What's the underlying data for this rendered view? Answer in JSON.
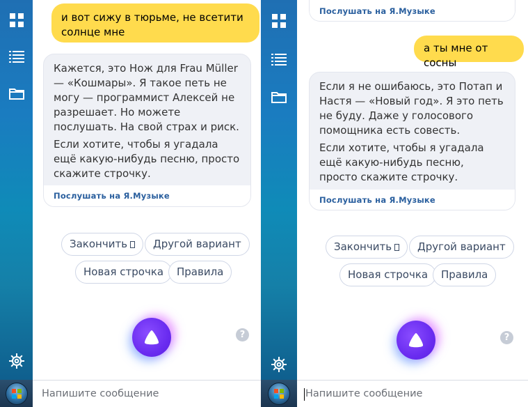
{
  "left": {
    "sidebar": {
      "icons": [
        "apps-grid-icon",
        "list-icon",
        "folder-icon",
        "settings-gear-icon"
      ]
    },
    "messages": {
      "user_text": "и вот сижу в тюрьме, не всетити солнце мне",
      "assistant_p1": "Кажется, это Нож для Frau Müller — «Кошмары». Я такое петь не могу — программист Алексей не разрешает. Но можете послушать. На свой страх и риск.",
      "assistant_p2": "Если хотите, чтобы я угадала ещё какую-нибудь песню, просто скажите строчку.",
      "listen_link": "Послушать на Я.Музыке"
    },
    "chips": {
      "finish": "Закончить",
      "other": "Другой вариант",
      "new_line": "Новая строчка",
      "rules": "Правила"
    },
    "help": "?",
    "input_placeholder": "Напишите сообщение"
  },
  "right": {
    "messages": {
      "prev_listen_link": "Послушать на Я.Музыке",
      "user_text": "а ты мне от сосны",
      "assistant_p1": "Если я не ошибаюсь, это Потап и Настя — «Новый год». Я это петь не буду. Даже у голосового помощника есть совесть.",
      "assistant_p2": "Если хотите, чтобы я угадала ещё какую-нибудь песню, просто скажите строчку.",
      "listen_link": "Послушать на Я.Музыке"
    },
    "chips": {
      "finish": "Закончить",
      "other": "Другой вариант",
      "new_line": "Новая строчка",
      "rules": "Правила"
    },
    "help": "?",
    "input_placeholder": "Напишите сообщение"
  },
  "colors": {
    "user_bubble": "#ffdb4d",
    "assistant_bubble": "#eff1f6",
    "link": "#2a5f9e",
    "alice_button": "#6a2cf0"
  }
}
